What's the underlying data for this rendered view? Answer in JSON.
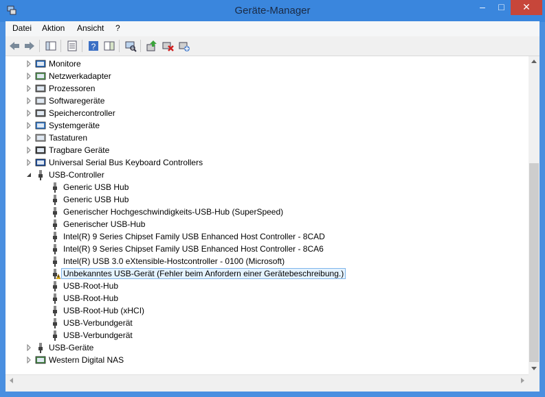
{
  "window": {
    "title": "Geräte-Manager",
    "controls": {
      "minimize": "–",
      "maximize": "□",
      "close": "✕"
    }
  },
  "menu": [
    "Datei",
    "Aktion",
    "Ansicht",
    "?"
  ],
  "tree": {
    "categories": [
      {
        "label": "Monitore",
        "icon": "monitor-icon"
      },
      {
        "label": "Netzwerkadapter",
        "icon": "network-adapter-icon"
      },
      {
        "label": "Prozessoren",
        "icon": "processor-icon"
      },
      {
        "label": "Softwaregeräte",
        "icon": "software-device-icon"
      },
      {
        "label": "Speichercontroller",
        "icon": "storage-controller-icon"
      },
      {
        "label": "Systemgeräte",
        "icon": "system-device-icon"
      },
      {
        "label": "Tastaturen",
        "icon": "keyboard-icon"
      },
      {
        "label": "Tragbare Geräte",
        "icon": "portable-device-icon"
      },
      {
        "label": "Universal Serial Bus Keyboard Controllers",
        "icon": "usb-keyboard-controller-icon"
      }
    ],
    "usb_controller": {
      "label": "USB-Controller",
      "children": [
        "Generic USB Hub",
        "Generic USB Hub",
        "Generischer Hochgeschwindigkeits-USB-Hub (SuperSpeed)",
        "Generischer USB-Hub",
        "Intel(R) 9 Series Chipset Family USB Enhanced Host Controller  - 8CAD",
        "Intel(R) 9 Series Chipset Family USB Enhanced Host Controller  - 8CA6",
        "Intel(R) USB 3.0 eXtensible-Hostcontroller - 0100 (Microsoft)",
        "Unbekanntes USB-Gerät (Fehler beim Anfordern einer Gerätebeschreibung.)",
        "USB-Root-Hub",
        "USB-Root-Hub",
        "USB-Root-Hub (xHCI)",
        "USB-Verbundgerät",
        "USB-Verbundgerät"
      ],
      "selected_index": 7
    },
    "after": [
      {
        "label": "USB-Geräte",
        "icon": "usb-device-icon"
      },
      {
        "label": "Western Digital NAS",
        "icon": "nas-icon"
      }
    ]
  }
}
